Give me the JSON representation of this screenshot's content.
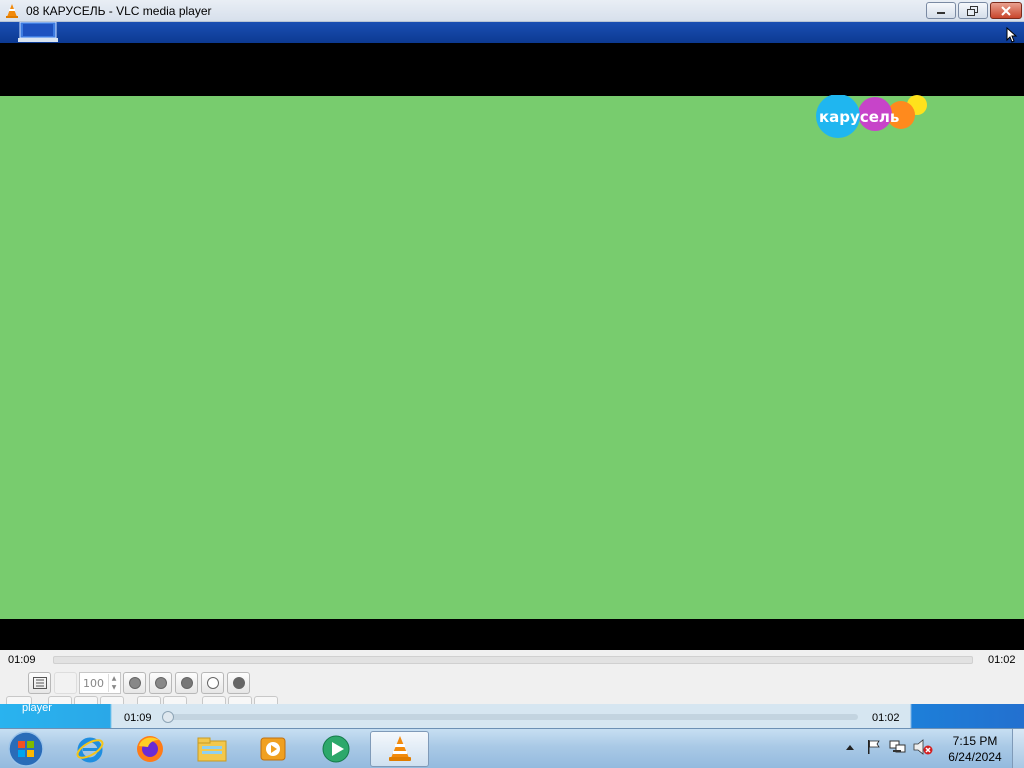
{
  "window": {
    "title": "08 КАРУСЕЛЬ - VLC media player"
  },
  "video": {
    "logo_text": "карусель",
    "background_color": "#78cc6e"
  },
  "seek": {
    "elapsed": "01:09",
    "remaining": "01:02"
  },
  "controls": {
    "volume_value": "100"
  },
  "mini_player": {
    "label": "player",
    "elapsed": "01:09",
    "remaining": "01:02"
  },
  "taskbar": {
    "apps": [
      "internet-explorer",
      "firefox",
      "file-explorer",
      "media-player",
      "media-center",
      "vlc"
    ],
    "active_app": "vlc",
    "time": "7:15 PM",
    "date": "6/24/2024"
  }
}
